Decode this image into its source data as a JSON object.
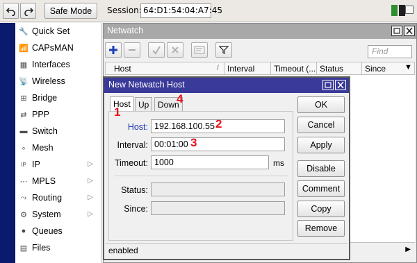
{
  "toolbar": {
    "undo_icon": "undo-icon",
    "redo_icon": "redo-icon",
    "safe_mode_label": "Safe Mode",
    "session_label": "Session:",
    "session_value": "64:D1:54:04:A7:45",
    "battery_colors": [
      "#2f8f2f",
      "#1f1f1f"
    ]
  },
  "sidebar": {
    "strip_color": "#0a1a6c",
    "items": [
      {
        "label": "Quick Set",
        "icon": "quick-set-icon",
        "has_submenu": false
      },
      {
        "label": "CAPsMAN",
        "icon": "capsman-icon",
        "has_submenu": false
      },
      {
        "label": "Interfaces",
        "icon": "interfaces-icon",
        "has_submenu": false
      },
      {
        "label": "Wireless",
        "icon": "wireless-icon",
        "has_submenu": false
      },
      {
        "label": "Bridge",
        "icon": "bridge-icon",
        "has_submenu": false
      },
      {
        "label": "PPP",
        "icon": "ppp-icon",
        "has_submenu": false
      },
      {
        "label": "Switch",
        "icon": "switch-icon",
        "has_submenu": false
      },
      {
        "label": "Mesh",
        "icon": "mesh-icon",
        "has_submenu": false
      },
      {
        "label": "IP",
        "icon": "ip-icon",
        "has_submenu": true
      },
      {
        "label": "MPLS",
        "icon": "mpls-icon",
        "has_submenu": true
      },
      {
        "label": "Routing",
        "icon": "routing-icon",
        "has_submenu": true
      },
      {
        "label": "System",
        "icon": "system-icon",
        "has_submenu": true
      },
      {
        "label": "Queues",
        "icon": "queues-icon",
        "has_submenu": false
      },
      {
        "label": "Files",
        "icon": "files-icon",
        "has_submenu": false
      }
    ]
  },
  "netwatch": {
    "title": "Netwatch",
    "find_placeholder": "Find",
    "columns": [
      "Host",
      "Interval",
      "Timeout (...",
      "Status",
      "Since"
    ],
    "toolbar_icons": [
      "add-icon",
      "remove-icon",
      "enable-icon",
      "disable-icon",
      "comment-icon",
      "filter-icon"
    ]
  },
  "dialog": {
    "title": "New Netwatch Host",
    "tabs": [
      "Host",
      "Up",
      "Down"
    ],
    "active_tab": "Host",
    "fields": {
      "host_label": "Host:",
      "host_value": "192.168.100.55",
      "interval_label": "Interval:",
      "interval_value": "00:01:00",
      "timeout_label": "Timeout:",
      "timeout_value": "1000",
      "timeout_unit": "ms",
      "status_label": "Status:",
      "status_value": "",
      "since_label": "Since:",
      "since_value": ""
    },
    "buttons": [
      "OK",
      "Cancel",
      "Apply",
      "Disable",
      "Comment",
      "Copy",
      "Remove"
    ],
    "status_text": "enabled"
  },
  "annotations": {
    "color": "#e4121c",
    "markers": [
      "1",
      "2",
      "3",
      "4"
    ]
  }
}
